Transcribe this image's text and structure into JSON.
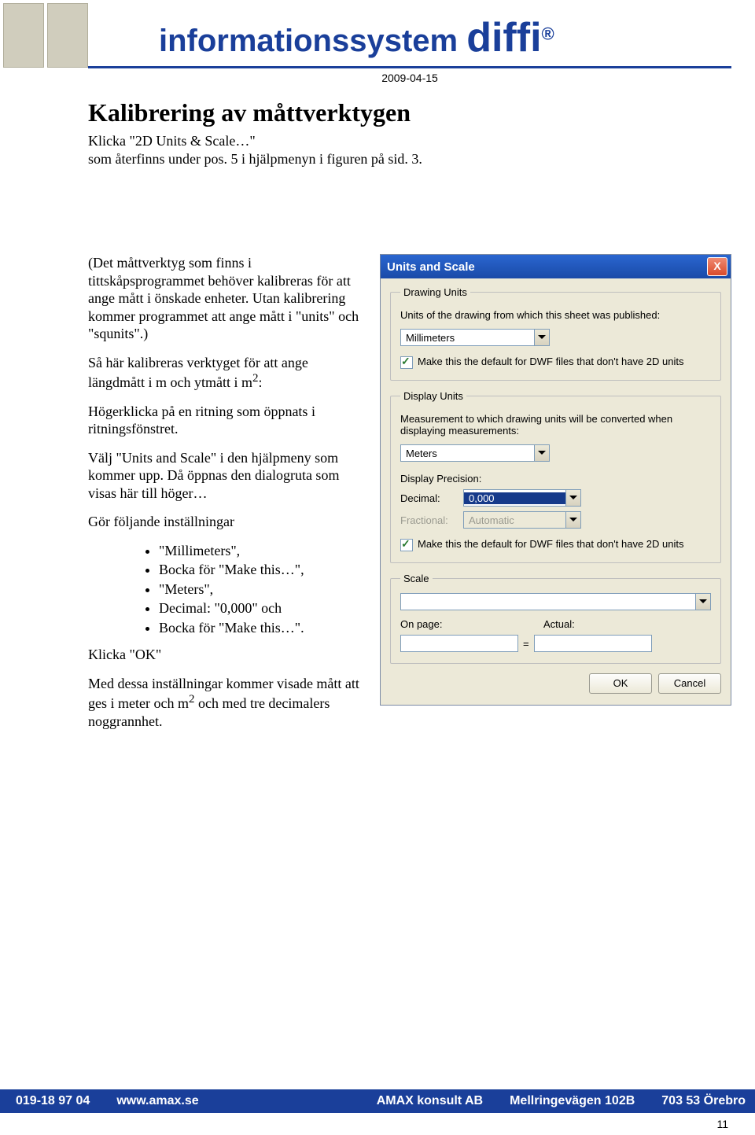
{
  "header": {
    "title_prefix": "informationssystem ",
    "brand": "diffi",
    "reg_mark": "®",
    "date": "2009-04-15"
  },
  "doc": {
    "heading": "Kalibrering av måttverktygen",
    "intro1": "Klicka \"2D Units & Scale…\"",
    "intro2": "som återfinns under pos. 5 i hjälpmenyn i figuren på sid. 3.",
    "para1": "(Det måttverktyg som finns i tittskåpsprogrammet behöver kalibreras för att ange mått i önskade enheter. Utan kalibrering kommer programmet att ange mått i \"units\" och \"squnits\".)",
    "para2a": "Så här kalibreras verktyget för att ange längdmått i m och ytmått i m",
    "para2sup": "2",
    "para2b": ":",
    "para3": "Högerklicka på en ritning som öppnats i ritningsfönstret.",
    "para4": "Välj \"Units and Scale\" i den hjälpmeny som kommer upp. Då öppnas den dialogruta som visas här till höger…",
    "para5": "Gör följande inställningar",
    "bullets": [
      "\"Millimeters\",",
      "Bocka för \"Make this…\",",
      "\"Meters\",",
      "Decimal: \"0,000\" och",
      "Bocka för \"Make this…\"."
    ],
    "para6": "Klicka \"OK\"",
    "para7a": "Med dessa inställningar kommer visade mått att ges i meter och m",
    "para7sup": "2",
    "para7b": " och med tre decimalers noggrannhet."
  },
  "dialog": {
    "title": "Units and Scale",
    "drawing_units": {
      "legend": "Drawing Units",
      "caption": "Units of the drawing from which this sheet was published:",
      "combo_value": "Millimeters",
      "checkbox_label": "Make this the default for DWF files that don't have 2D units"
    },
    "display_units": {
      "legend": "Display Units",
      "caption": "Measurement to which drawing units will be converted when displaying measurements:",
      "combo_value": "Meters",
      "precision_label": "Display Precision:",
      "decimal_label": "Decimal:",
      "decimal_value": "0,000",
      "fractional_label": "Fractional:",
      "fractional_value": "Automatic",
      "checkbox_label": "Make this the default for DWF files that don't have 2D units"
    },
    "scale": {
      "legend": "Scale",
      "combo_value": "",
      "onpage_label": "On page:",
      "actual_label": "Actual:",
      "equals": "="
    },
    "buttons": {
      "ok": "OK",
      "cancel": "Cancel"
    }
  },
  "footer": {
    "phone": "019-18 97 04",
    "url": "www.amax.se",
    "company": "AMAX konsult AB",
    "address": "Mellringevägen 102B",
    "postal": "703 53 Örebro"
  },
  "page_number": "11"
}
